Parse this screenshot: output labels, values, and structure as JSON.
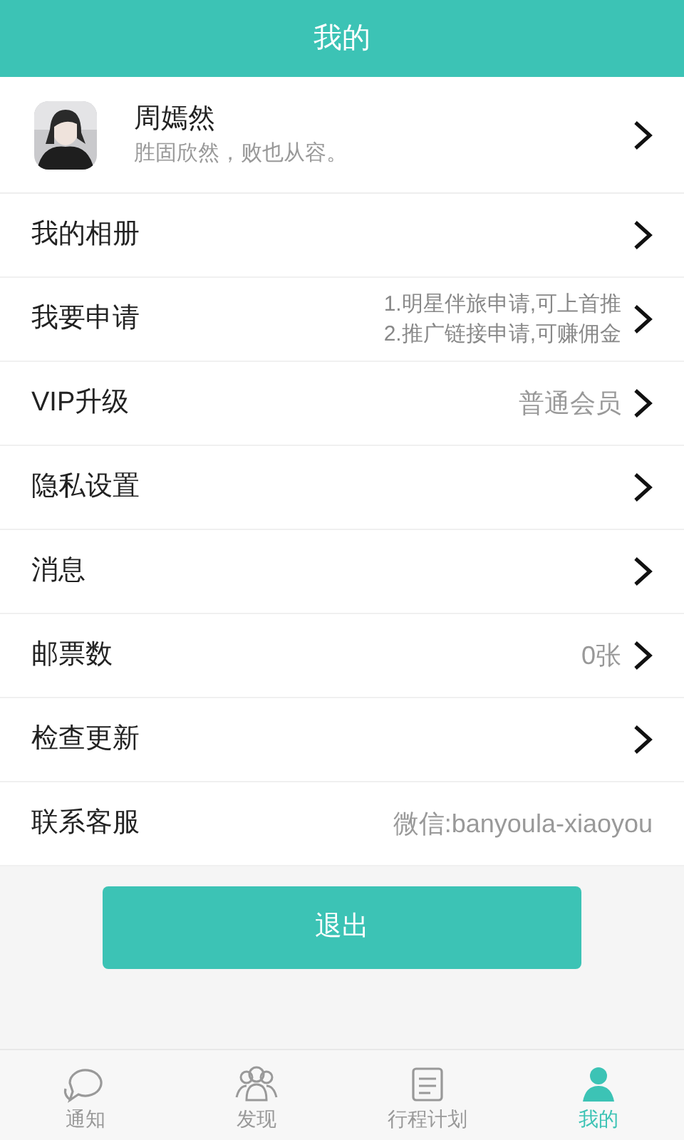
{
  "header": {
    "title": "我的"
  },
  "profile": {
    "name": "周嫣然",
    "motto": "胜固欣然，败也从容。"
  },
  "rows": [
    {
      "label": "我的相册",
      "arrow": true
    },
    {
      "label": "我要申请",
      "notes": [
        "1.明星伴旅申请,可上首推",
        "2.推广链接申请,可赚佣金"
      ],
      "arrow": true
    },
    {
      "label": "VIP升级",
      "value": "普通会员",
      "arrow": true
    },
    {
      "label": "隐私设置",
      "arrow": true
    },
    {
      "label": "消息",
      "arrow": true
    },
    {
      "label": "邮票数",
      "value": "0张",
      "arrow": true
    },
    {
      "label": "检查更新",
      "arrow": true
    },
    {
      "label": "联系客服",
      "value": "微信:banyoula-xiaoyou",
      "arrow": false
    }
  ],
  "logout_button": "退出",
  "tabs": [
    {
      "label": "通知",
      "kind": "chat",
      "selected": false
    },
    {
      "label": "发现",
      "kind": "people",
      "selected": false
    },
    {
      "label": "行程计划",
      "kind": "plan",
      "selected": false
    },
    {
      "label": "我的",
      "kind": "me",
      "selected": true
    }
  ]
}
